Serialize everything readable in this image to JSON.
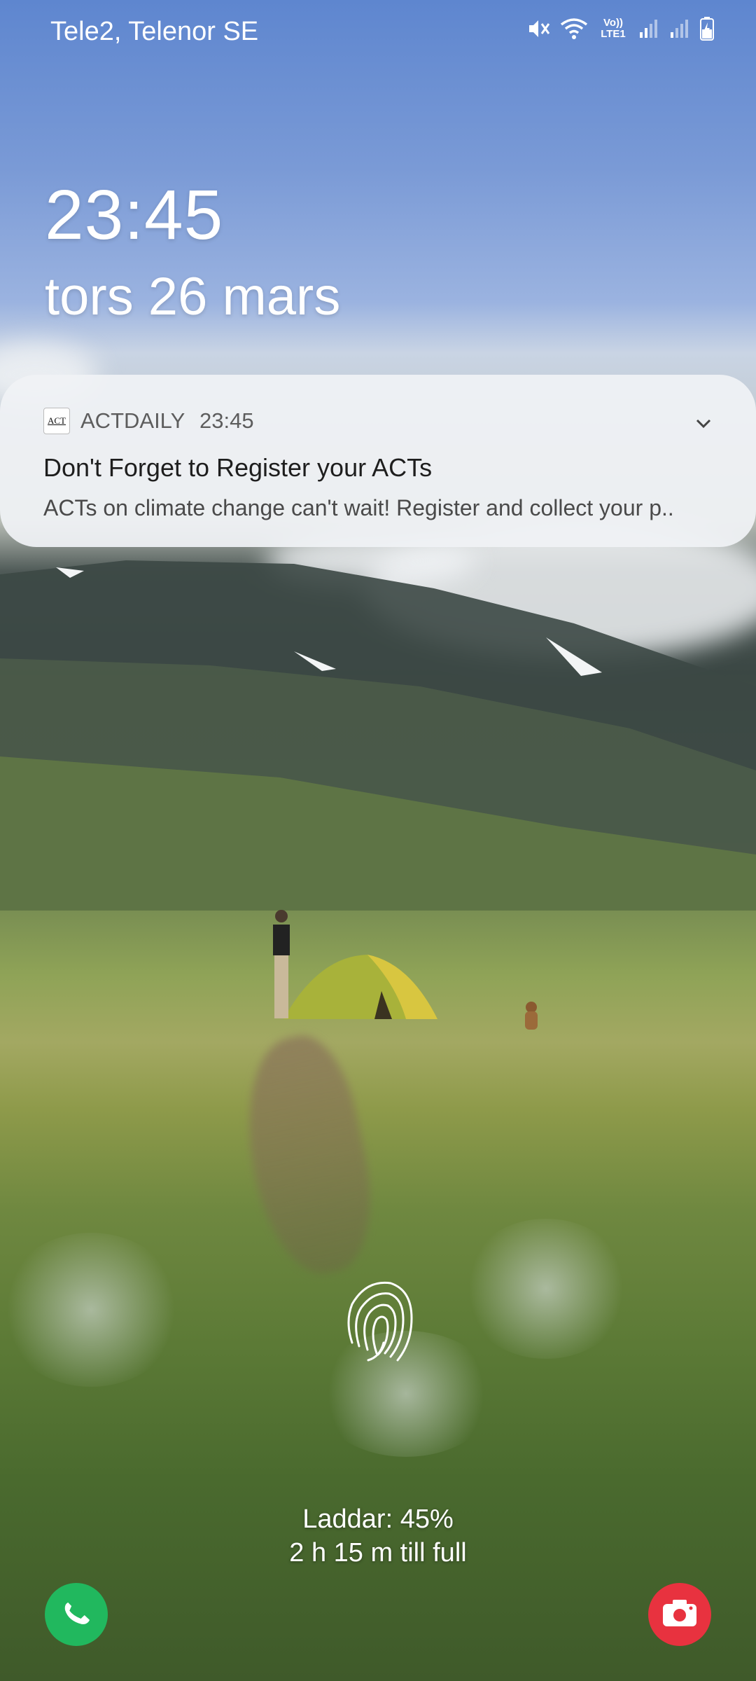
{
  "status_bar": {
    "carrier": "Tele2, Telenor SE",
    "network_label": "Vo)) LTE1",
    "icons": [
      "mute-icon",
      "wifi-icon",
      "volte-icon",
      "signal-sim1-icon",
      "signal-sim2-icon",
      "battery-charging-icon"
    ]
  },
  "lock_screen": {
    "time": "23:45",
    "date": "tors 26 mars"
  },
  "notification": {
    "app_icon_text": "ACT",
    "app_name": "ACTDAILY",
    "time": "23:45",
    "title": "Don't Forget to Register your ACTs",
    "body": "ACTs on climate change can't wait! Register and collect your p.."
  },
  "charging": {
    "status": "Laddar: 45%",
    "remaining": "2 h 15 m till full"
  },
  "shortcuts": {
    "left_icon": "phone-icon",
    "right_icon": "camera-icon"
  },
  "colors": {
    "phone_shortcut": "#21b85e",
    "camera_shortcut": "#e8323f",
    "notification_bg": "#f0f2f5"
  }
}
